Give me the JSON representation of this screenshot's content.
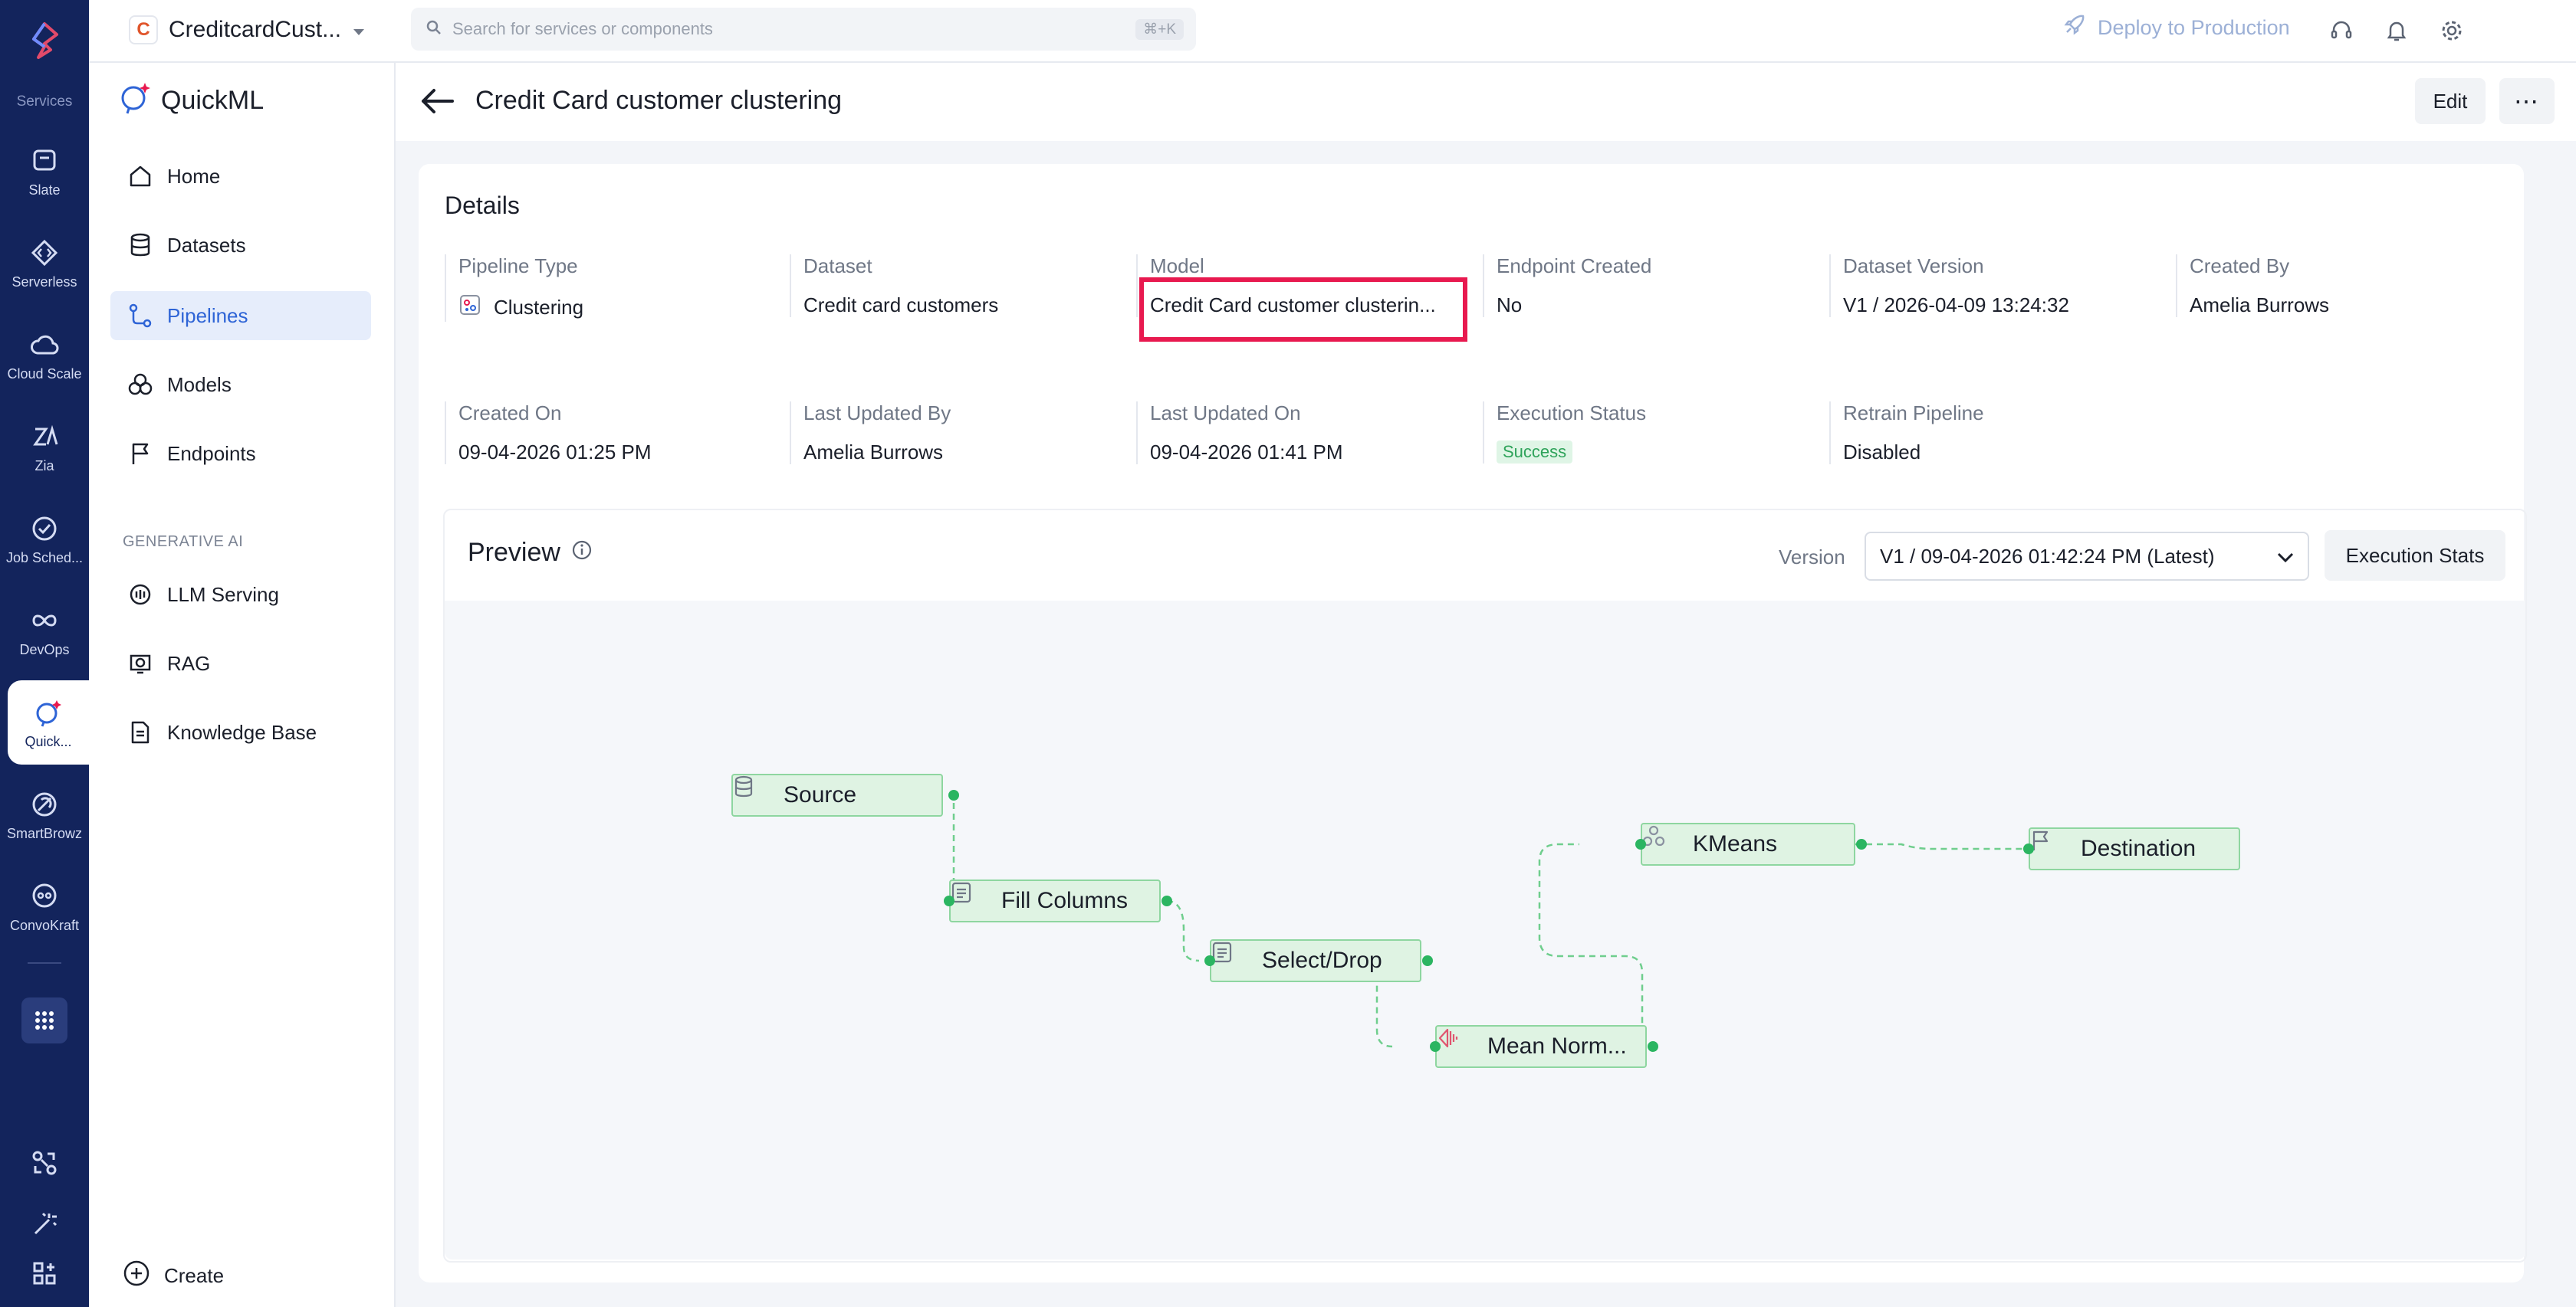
{
  "topbar": {
    "project_initial": "C",
    "project_name": "CreditcardCust...",
    "search_placeholder": "Search for services or components",
    "search_shortcut": "⌘+K",
    "deploy_label": "Deploy to Production"
  },
  "rail": {
    "section_label": "Services",
    "items": [
      {
        "label": "Slate"
      },
      {
        "label": "Serverless"
      },
      {
        "label": "Cloud Scale"
      },
      {
        "label": "Zia"
      },
      {
        "label": "Job Sched..."
      },
      {
        "label": "DevOps"
      },
      {
        "label": "Quick..."
      },
      {
        "label": "SmartBrowz"
      },
      {
        "label": "ConvoKraft"
      }
    ]
  },
  "sidebar": {
    "brand": "QuickML",
    "nav": [
      {
        "label": "Home"
      },
      {
        "label": "Datasets"
      },
      {
        "label": "Pipelines"
      },
      {
        "label": "Models"
      },
      {
        "label": "Endpoints"
      }
    ],
    "group_label": "GENERATIVE AI",
    "genai": [
      {
        "label": "LLM Serving"
      },
      {
        "label": "RAG"
      },
      {
        "label": "Knowledge Base"
      }
    ],
    "create_label": "Create"
  },
  "page": {
    "title": "Credit Card customer clustering",
    "edit_label": "Edit",
    "more_label": "⋯"
  },
  "details": {
    "title": "Details",
    "fields": [
      {
        "label": "Pipeline Type",
        "value": "Clustering"
      },
      {
        "label": "Dataset",
        "value": "Credit card customers"
      },
      {
        "label": "Model",
        "value": "Credit Card customer clusterin..."
      },
      {
        "label": "Endpoint Created",
        "value": "No"
      },
      {
        "label": "Dataset Version",
        "value": "V1 / 2026-04-09 13:24:32"
      },
      {
        "label": "Created By",
        "value": "Amelia Burrows"
      },
      {
        "label": "Created On",
        "value": "09-04-2026 01:25 PM"
      },
      {
        "label": "Last Updated By",
        "value": "Amelia Burrows"
      },
      {
        "label": "Last Updated On",
        "value": "09-04-2026 01:41 PM"
      },
      {
        "label": "Execution Status",
        "value": "Success"
      },
      {
        "label": "Retrain Pipeline",
        "value": "Disabled"
      }
    ]
  },
  "preview": {
    "title": "Preview",
    "version_label": "Version",
    "version_value": "V1 / 09-04-2026 01:42:24 PM (Latest)",
    "stats_label": "Execution Stats",
    "nodes": [
      {
        "label": "Source",
        "icon": "database-icon"
      },
      {
        "label": "Fill Columns",
        "icon": "document-icon"
      },
      {
        "label": "Select/Drop",
        "icon": "document-icon"
      },
      {
        "label": "Mean Norm...",
        "icon": "normalize-icon"
      },
      {
        "label": "KMeans",
        "icon": "cluster-icon"
      },
      {
        "label": "Destination",
        "icon": "flag-icon"
      }
    ]
  },
  "colors": {
    "rail_bg": "#13245c",
    "accent": "#2e64d6",
    "node_fill": "#dff3e3",
    "node_border": "#8ed6a0",
    "connector": "#2bb561",
    "highlight": "#e8194f"
  }
}
